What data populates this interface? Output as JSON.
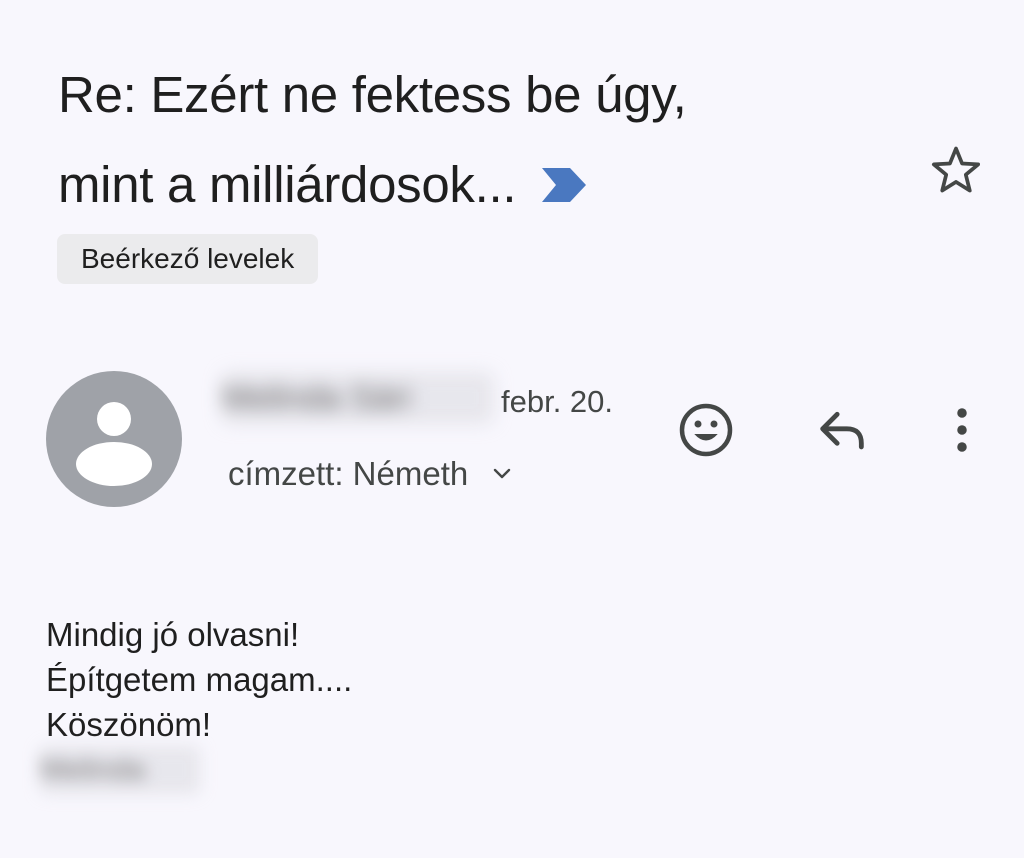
{
  "email": {
    "subject_line_1": "Re: Ezért ne fektess be úgy,",
    "subject_line_2": "mint a milliárdosok...",
    "label": "Beérkező levelek",
    "sender_name": "Melinda Sári",
    "date": "febr. 20.",
    "recipient": "címzett: Németh",
    "body": [
      "Mindig jó olvasni!",
      "Építgetem magam....",
      "Köszönöm!"
    ],
    "signature": "Melinda"
  },
  "icons": {
    "importance": "importance-marker-icon",
    "star": "star-outline-icon",
    "avatar": "person-avatar-icon",
    "emoji": "emoji-reaction-icon",
    "reply": "reply-icon",
    "more": "more-vert-icon",
    "expand": "chevron-down-icon"
  },
  "colors": {
    "background": "#f8f7fd",
    "importance_marker": "#4a78c0",
    "avatar_bg": "#9fa2a8",
    "chip_bg": "#ebebed"
  }
}
